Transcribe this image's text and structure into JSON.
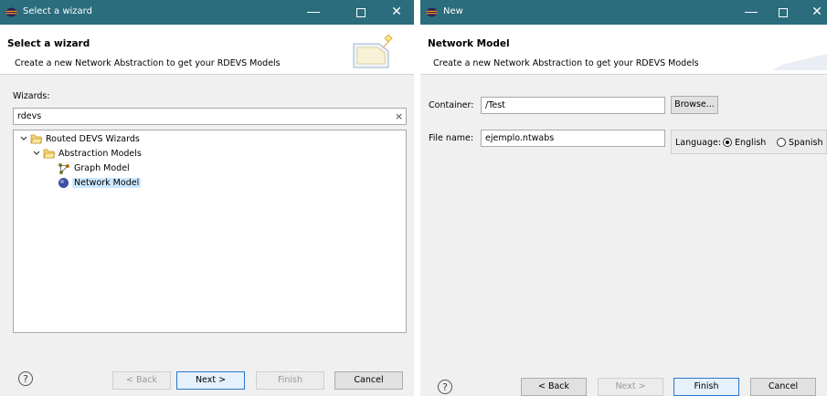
{
  "left_dialog": {
    "window_title": "Select a wizard",
    "heading": "Select a wizard",
    "description": "Create a new Network Abstraction to get your RDEVS Models",
    "wizards_label": "Wizards:",
    "filter_value": "rdevs",
    "tree": {
      "root": "Routed DEVS Wizards",
      "group": "Abstraction Models",
      "items": [
        "Graph Model",
        "Network Model"
      ],
      "selected": "Network Model"
    },
    "buttons": {
      "back": "< Back",
      "next": "Next >",
      "finish": "Finish",
      "cancel": "Cancel"
    }
  },
  "right_dialog": {
    "window_title": "New",
    "heading": "Network Model",
    "description": "Create a new Network Abstraction to get your RDEVS Models",
    "container_label": "Container:",
    "container_value": "/Test",
    "browse_label": "Browse...",
    "file_name_label": "File name:",
    "file_name_value": "ejemplo.ntwabs",
    "language_label": "Language:",
    "language_options": [
      "English",
      "Spanish"
    ],
    "language_selected": "English",
    "buttons": {
      "back": "< Back",
      "next": "Next >",
      "finish": "Finish",
      "cancel": "Cancel"
    }
  },
  "icons": {
    "app": "eclipse-icon",
    "help": "help-icon",
    "folder": "folder-icon",
    "graph": "graph-model-icon",
    "network": "network-model-icon",
    "wizard_banner": "wizard-banner-icon"
  },
  "colors": {
    "titlebar": "#2b6d7d",
    "selection": "#cce8ff",
    "default_button_border": "#2a77c7"
  }
}
